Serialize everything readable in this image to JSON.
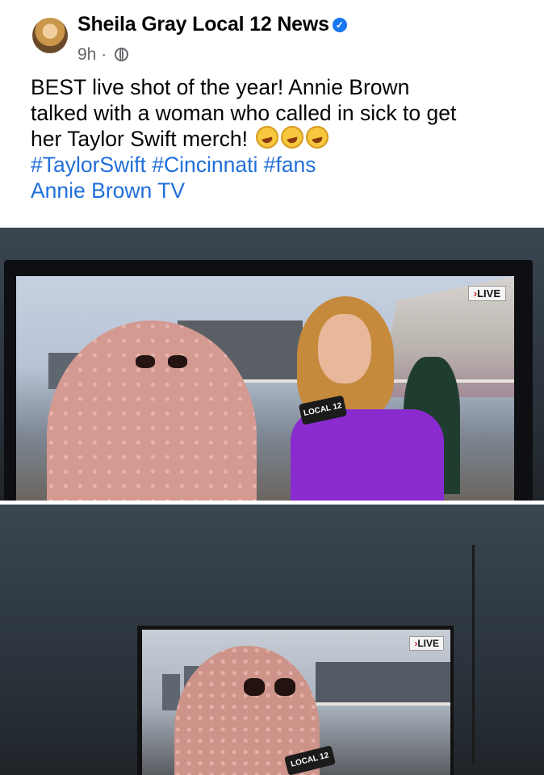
{
  "post": {
    "author": "Sheila Gray Local 12 News",
    "timestamp": "9h",
    "separator": "·",
    "text_lines": [
      "BEST live shot of the year! Annie Brown",
      "talked with a woman who called in sick to get",
      "her Taylor Swift merch!"
    ],
    "hashtags": [
      "#TaylorSwift",
      "#Cincinnati",
      "#fans"
    ],
    "tagged_link": "Annie Brown TV",
    "emoji": [
      "rolling-on-floor-laughing-emoji",
      "rolling-on-floor-laughing-emoji",
      "rolling-on-floor-laughing-emoji"
    ]
  },
  "photos": [
    {
      "overlay_badge": "LIVE",
      "mic_flag": "LOCAL 12"
    },
    {
      "overlay_badge": "LIVE",
      "mic_flag": "LOCAL 12"
    }
  ],
  "colors": {
    "link": "#216fdb",
    "verified": "#1877f2",
    "meta": "#65676b",
    "dress": "#8a2bd0",
    "blanket": "#d49990"
  }
}
